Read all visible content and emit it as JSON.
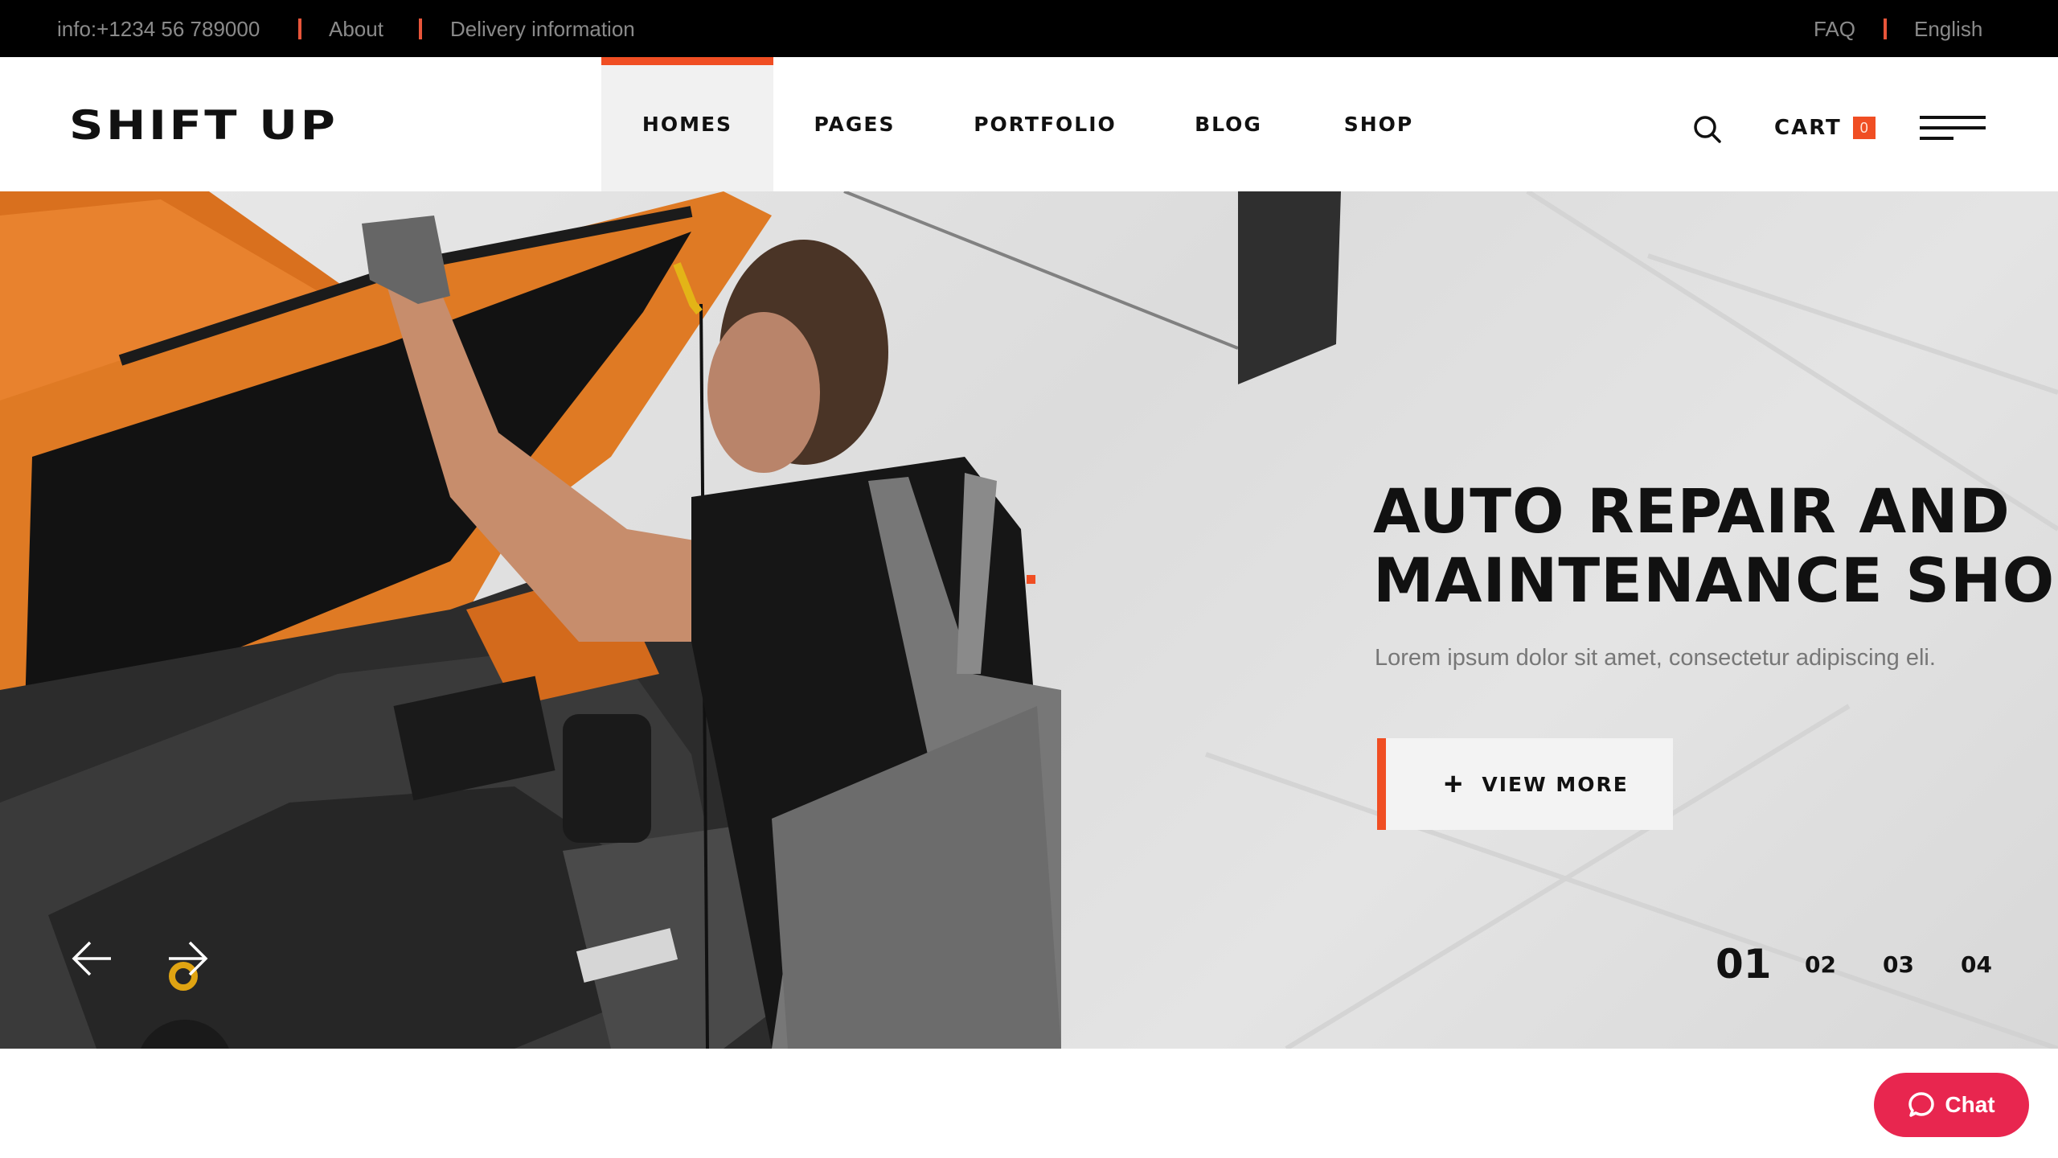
{
  "topbar": {
    "left_items": [
      "info:+1234 56 789000",
      "About",
      "Delivery information"
    ],
    "right_items": [
      "FAQ",
      "English"
    ],
    "separator_color": "#e8553a"
  },
  "header": {
    "logo": "SHIFT UP",
    "nav": [
      {
        "label": "HOMES",
        "active": true
      },
      {
        "label": "PAGES",
        "active": false
      },
      {
        "label": "PORTFOLIO",
        "active": false
      },
      {
        "label": "BLOG",
        "active": false
      },
      {
        "label": "SHOP",
        "active": false
      }
    ],
    "search_icon": "search-icon",
    "cart_label": "CART",
    "cart_count": "0",
    "menu_icon": "hamburger-menu-icon"
  },
  "hero": {
    "title_line1": "AUTO REPAIR AND",
    "title_line2": "MAINTENANCE SHOP",
    "subtitle": "Lorem ipsum dolor sit amet, consectetur adipiscing eli.",
    "cta_icon": "+",
    "cta_label": "VIEW MORE",
    "image_alt": "Mechanic inspecting engine of orange car",
    "slides": [
      "01",
      "02",
      "03",
      "04"
    ],
    "active_slide": "01",
    "prev_icon": "arrow-left-icon",
    "next_icon": "arrow-right-icon"
  },
  "chat": {
    "label": "Chat",
    "icon": "chat-bubble-icon",
    "color": "#e8264f"
  },
  "colors": {
    "accent": "#f04e23",
    "topbar_bg": "#000000",
    "text_dark": "#111111"
  }
}
